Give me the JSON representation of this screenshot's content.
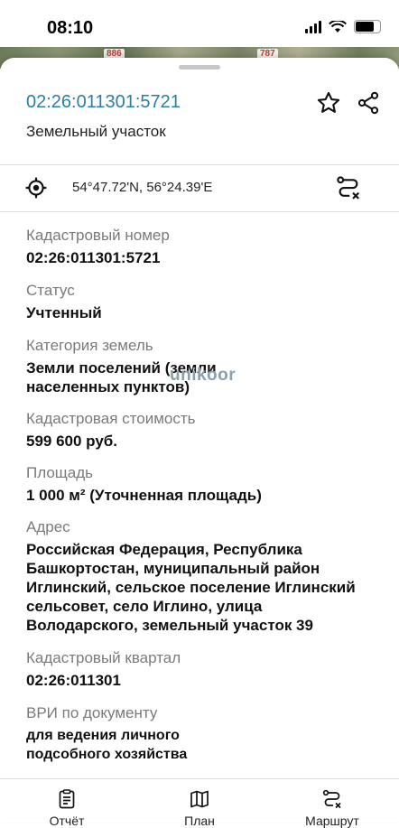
{
  "status_bar": {
    "time": "08:10"
  },
  "map": {
    "labels": [
      "886",
      "787"
    ]
  },
  "header": {
    "cadastral_number": "02:26:011301:5721",
    "object_type": "Земельный участок"
  },
  "location": {
    "coordinates": "54°47.72'N, 56°24.39'E"
  },
  "fields": [
    {
      "label": "Кадастровый номер",
      "value": "02:26:011301:5721"
    },
    {
      "label": "Статус",
      "value": "Учтенный"
    },
    {
      "label": "Категория земель",
      "value": "Земли поселений (земли\nнаселенных пунктов)"
    },
    {
      "label": "Кадастровая стоимость",
      "value": "599 600 руб."
    },
    {
      "label": "Площадь",
      "value": "1 000 м² (Уточненная площадь)"
    },
    {
      "label": "Адрес",
      "value": "Российская Федерация, Республика\nБашкортостан, муниципальный район\nИглинский, сельское поселение Иглинский\nсельсовет, село Иглино, улица\nВолодарского, земельный участок 39"
    },
    {
      "label": "Кадастровый квартал",
      "value": "02:26:011301"
    },
    {
      "label": "ВРИ по документу",
      "value": "для ведения личного\nподсобного хозяйства"
    }
  ],
  "watermark": "unikoor",
  "tabs": [
    {
      "label": "Отчёт",
      "icon": "report-icon"
    },
    {
      "label": "План",
      "icon": "map-icon"
    },
    {
      "label": "Маршрут",
      "icon": "route-icon"
    }
  ],
  "colors": {
    "accent": "#2a7fa3",
    "muted": "#7a7a7a"
  }
}
